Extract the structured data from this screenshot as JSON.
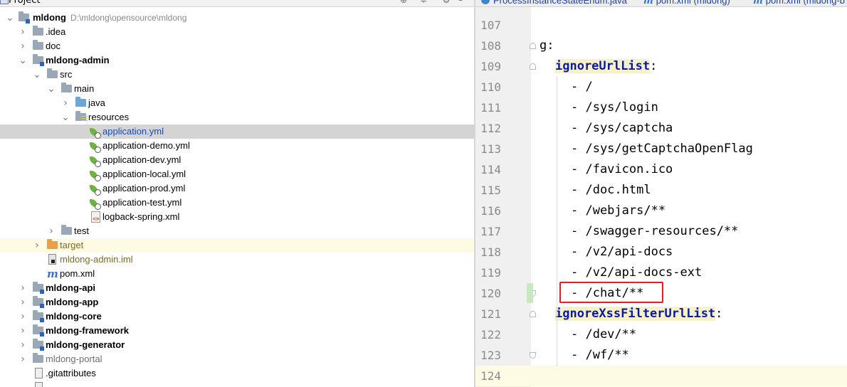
{
  "project_panel": {
    "title": "Project",
    "tree": [
      {
        "label": "mldong",
        "path": "D:\\mldong\\opensource\\mldong"
      },
      {
        "label": ".idea"
      },
      {
        "label": "doc"
      },
      {
        "label": "mldong-admin"
      },
      {
        "label": "src"
      },
      {
        "label": "main"
      },
      {
        "label": "java"
      },
      {
        "label": "resources"
      },
      {
        "label": "application.yml"
      },
      {
        "label": "application-demo.yml"
      },
      {
        "label": "application-dev.yml"
      },
      {
        "label": "application-local.yml"
      },
      {
        "label": "application-prod.yml"
      },
      {
        "label": "application-test.yml"
      },
      {
        "label": "logback-spring.xml"
      },
      {
        "label": "test"
      },
      {
        "label": "target"
      },
      {
        "label": "mldong-admin.iml"
      },
      {
        "label": "pom.xml"
      },
      {
        "label": "mldong-api"
      },
      {
        "label": "mldong-app"
      },
      {
        "label": "mldong-core"
      },
      {
        "label": "mldong-framework"
      },
      {
        "label": "mldong-generator"
      },
      {
        "label": "mldong-portal"
      },
      {
        "label": ".gitattributes"
      }
    ]
  },
  "editor": {
    "tabs": [
      {
        "label": "ProcessInstanceStateEnum.java"
      },
      {
        "label": "pom.xml (mldong)"
      },
      {
        "label": "pom.xml (mldong-b"
      }
    ],
    "lines": [
      {
        "num": "107",
        "text": ""
      },
      {
        "num": "108",
        "text": "g:"
      },
      {
        "num": "109",
        "key": "ignoreUrlList",
        "text": ":"
      },
      {
        "num": "110",
        "text": "- /"
      },
      {
        "num": "111",
        "text": "- /sys/login"
      },
      {
        "num": "112",
        "text": "- /sys/captcha"
      },
      {
        "num": "113",
        "text": "- /sys/getCaptchaOpenFlag"
      },
      {
        "num": "114",
        "text": "- /favicon.ico"
      },
      {
        "num": "115",
        "text": "- /doc.html"
      },
      {
        "num": "116",
        "text": "- /webjars/**"
      },
      {
        "num": "117",
        "text": "- /swagger-resources/**"
      },
      {
        "num": "118",
        "text": "- /v2/api-docs"
      },
      {
        "num": "119",
        "text": "- /v2/api-docs-ext"
      },
      {
        "num": "120",
        "text": "- /chat/**"
      },
      {
        "num": "121",
        "key": "ignoreXssFilterUrlList",
        "text": ":"
      },
      {
        "num": "122",
        "text": "- /dev/**"
      },
      {
        "num": "123",
        "text": "- /wf/**"
      },
      {
        "num": "124",
        "text": ""
      }
    ]
  },
  "colors": {
    "selection": "#d4d4d4",
    "current_line": "#fdfbe3",
    "key": "#0a1aa0",
    "highlight_box": "#e02020"
  }
}
